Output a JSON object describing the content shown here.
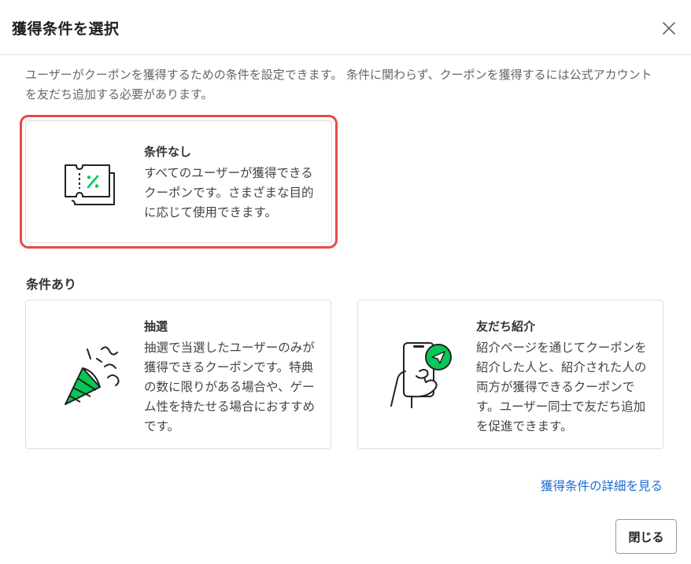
{
  "header": {
    "title": "獲得条件を選択"
  },
  "description": "ユーザーがクーポンを獲得するための条件を設定できます。 条件に関わらず、クーポンを獲得するには公式アカウントを友だち追加する必要があります。",
  "no_condition_card": {
    "title": "条件なし",
    "text": "すべてのユーザーが獲得できるクーポンです。さまざまな目的に応じて使用できます。",
    "icon": "coupon-ticket-icon",
    "selected": true
  },
  "section_label": "条件あり",
  "lottery_card": {
    "title": "抽選",
    "text": "抽選で当選したユーザーのみが獲得できるクーポンです。特典の数に限りがある場合や、ゲーム性を持たせる場合におすすめです。",
    "icon": "party-popper-icon"
  },
  "referral_card": {
    "title": "友だち紹介",
    "text": "紹介ページを通じてクーポンを紹介した人と、紹介された人の両方が獲得できるクーポンです。ユーザー同士で友だち追加を促進できます。",
    "icon": "phone-share-icon"
  },
  "detail_link": "獲得条件の詳細を見る",
  "close_button": "閉じる",
  "colors": {
    "accent_green": "#06c755",
    "link_blue": "#1a6bd1",
    "selected_outline": "#e84a4a"
  }
}
